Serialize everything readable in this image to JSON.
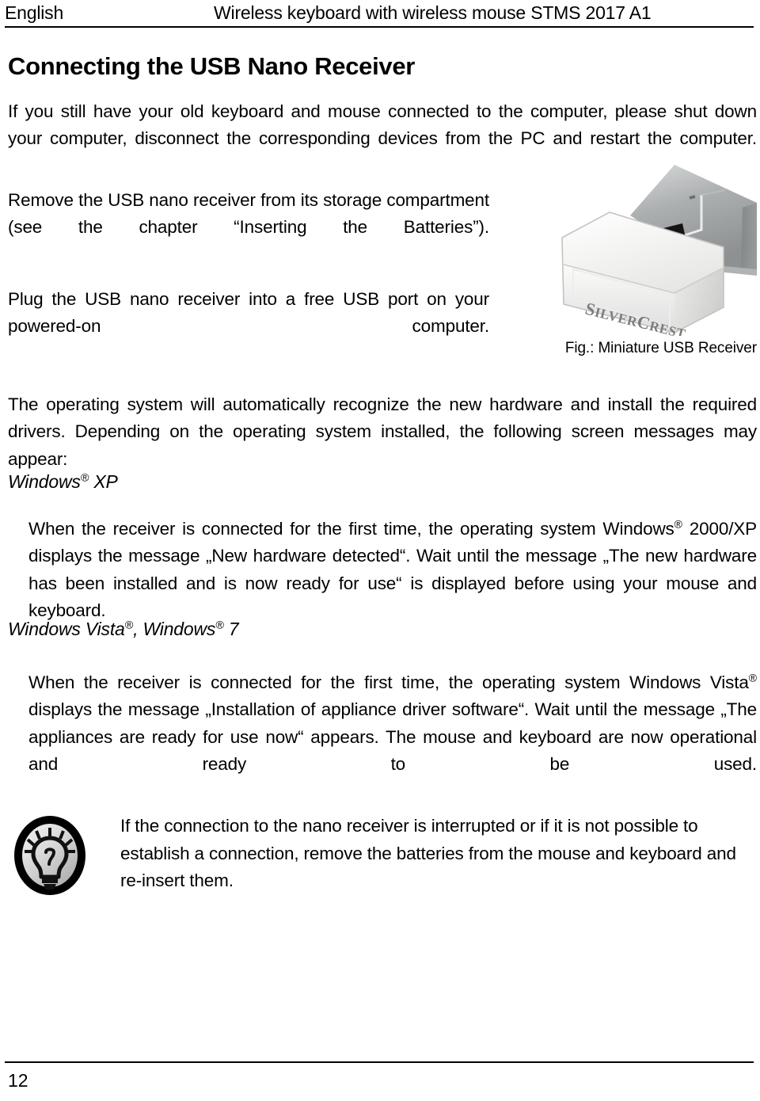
{
  "header": {
    "language": "English",
    "product_title": "Wireless keyboard with wireless mouse STMS 2017 A1"
  },
  "heading": "Connecting the USB Nano Receiver",
  "paragraphs": {
    "intro": "If you still have your old keyboard and mouse connected to the computer, please shut down your computer, disconnect the corresponding devices from the PC and restart the computer.",
    "remove": "Remove the USB nano receiver from its storage compartment (see the chapter “Inserting the Batteries”).",
    "plug": "Plug the USB nano receiver into a free USB port on your powered-on computer.",
    "operating_system": "The operating system will automatically recognize the new hardware and install the required drivers. Depending on the operating system installed, the following screen messages may appear:"
  },
  "figure": {
    "caption": "Fig.: Miniature USB Receiver",
    "brand_label": "SILVERCREST",
    "alt": "miniature-usb-receiver-photo"
  },
  "os_sections": [
    {
      "id": "windows-xp",
      "title_prefix": "Windows",
      "title_reg": "®",
      "title_suffix": " XP",
      "body_part1": "When the receiver is connected for the first time, the operating system Windows",
      "body_reg1": "®",
      "body_part2": " 2000/XP displays the message „New hardware detected“. Wait until the message „The new hardware has been installed and is now ready for use“ is displayed before using your mouse and keyboard."
    },
    {
      "id": "windows-vista-7",
      "title_prefix": "Windows Vista",
      "title_reg": "®",
      "title_mid": ", Windows",
      "title_reg2": "®",
      "title_suffix": " 7",
      "body_part1": "When the receiver is connected for the first time, the operating system Windows Vista",
      "body_reg1": "®",
      "body_part2": " displays the message „Installation of appliance driver software“. Wait until the message „The appliances are ready for use now“ appears. The mouse and keyboard are now operational and ready to be used."
    }
  ],
  "note": {
    "icon": "lightbulb-tip-icon",
    "text": "If the connection to the nano receiver is interrupted or if it is not possible to establish a connection, remove the batteries from the mouse and keyboard and re-insert them."
  },
  "footer": {
    "page_number": "12"
  },
  "colors": {
    "text": "#000000",
    "background": "#ffffff",
    "rule": "#000000",
    "receiver_body": "#f2f2f0",
    "receiver_metal": "#9a9c9d",
    "icon_fill": "#c9c9c9"
  }
}
